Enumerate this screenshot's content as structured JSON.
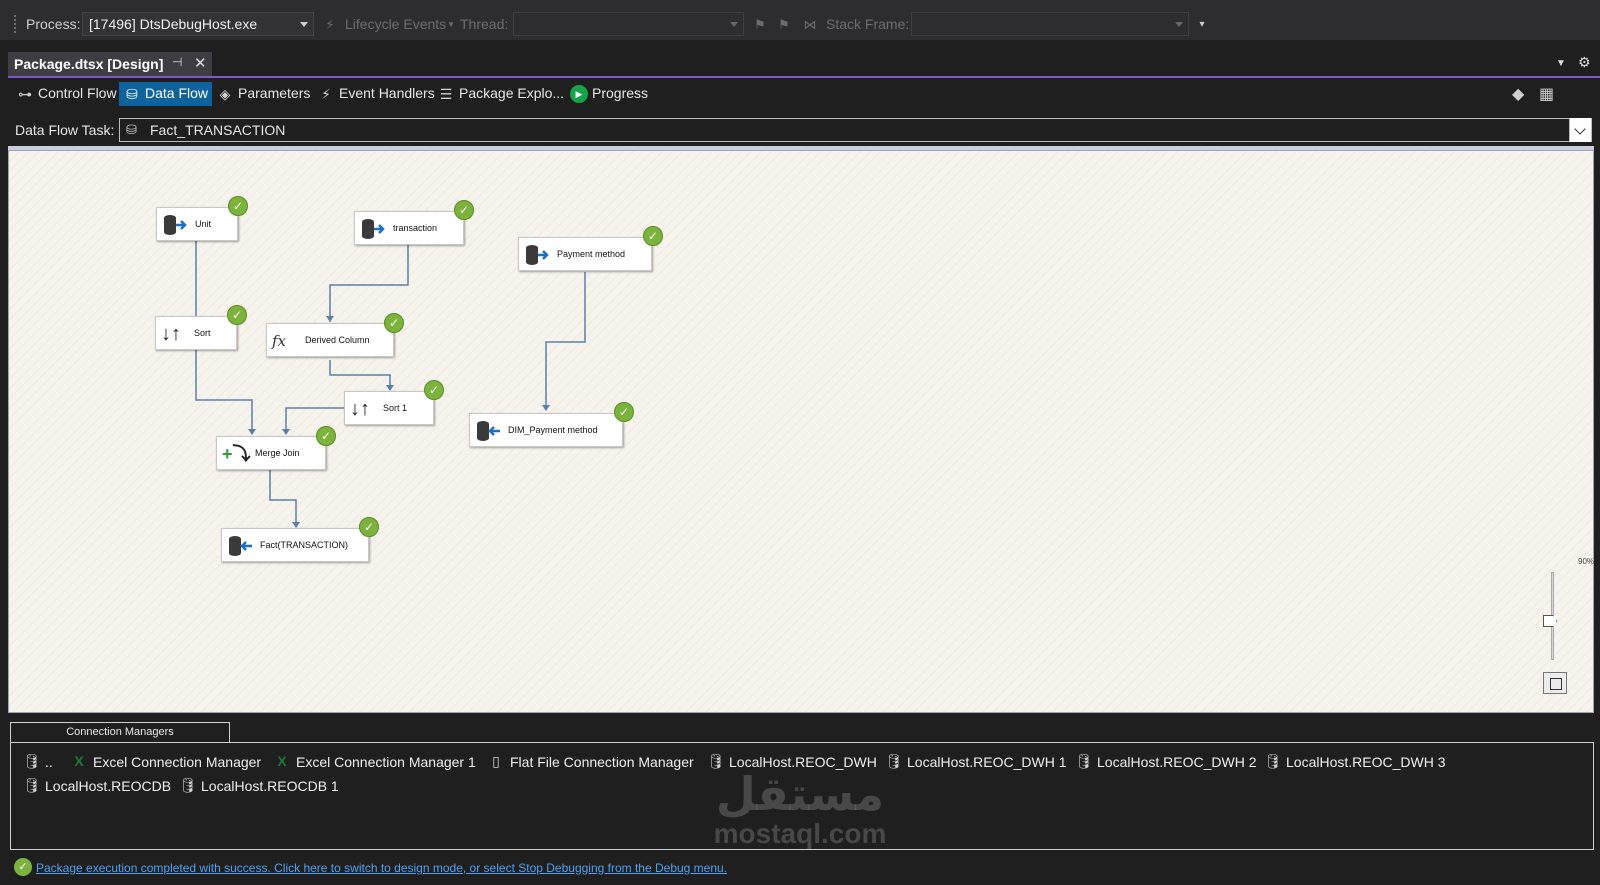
{
  "debug_toolbar": {
    "process_label": "Process:",
    "process_value": "[17496] DtsDebugHost.exe",
    "lifecycle_label": "Lifecycle Events",
    "thread_label": "Thread:",
    "stack_frame_label": "Stack Frame:"
  },
  "document_tab": {
    "title": "Package.dtsx [Design]",
    "pin_icon": "pin-icon",
    "close_icon": "close-icon"
  },
  "designer_tabs": [
    {
      "label": "Control Flow",
      "icon": "control-flow-icon"
    },
    {
      "label": "Data Flow",
      "icon": "data-flow-icon",
      "active": true
    },
    {
      "label": "Parameters",
      "icon": "parameters-icon"
    },
    {
      "label": "Event Handlers",
      "icon": "event-handlers-icon"
    },
    {
      "label": "Package Explo...",
      "icon": "package-explorer-icon"
    },
    {
      "label": "Progress",
      "icon": "progress-icon"
    }
  ],
  "task": {
    "label": "Data Flow Task:",
    "value": "Fact_TRANSACTION"
  },
  "components": {
    "unit": "Unit",
    "transaction": "transaction",
    "payment_method": "Payment method",
    "sort": "Sort",
    "derived_column": "Derived Column",
    "sort1": "Sort 1",
    "merge_join": "Merge Join",
    "dim_payment_method": "DIM_Payment method",
    "fact_transaction": "Fact(TRANSACTION)"
  },
  "zoom": {
    "label": "90%",
    "value": 90
  },
  "connection_managers": {
    "tab_label": "Connection Managers",
    "items": [
      {
        "label": "..",
        "icon": "database-icon"
      },
      {
        "label": "Excel Connection Manager",
        "icon": "excel-icon"
      },
      {
        "label": "Excel Connection Manager 1",
        "icon": "excel-icon"
      },
      {
        "label": "Flat File Connection Manager",
        "icon": "flat-file-icon"
      },
      {
        "label": "LocalHost.REOC_DWH",
        "icon": "database-icon"
      },
      {
        "label": "LocalHost.REOC_DWH 1",
        "icon": "database-icon"
      },
      {
        "label": "LocalHost.REOC_DWH 2",
        "icon": "database-icon"
      },
      {
        "label": "LocalHost.REOC_DWH 3",
        "icon": "database-icon"
      },
      {
        "label": "LocalHost.REOCDB",
        "icon": "database-icon"
      },
      {
        "label": "LocalHost.REOCDB 1",
        "icon": "database-icon"
      }
    ]
  },
  "status": {
    "message": "Package execution completed with success. Click here to switch to design mode, or select Stop Debugging from the Debug menu."
  },
  "watermark": {
    "arabic": "مستقل",
    "latin": "mostaql.com"
  },
  "colors": {
    "accent": "#0e639c",
    "success": "#7bb33c",
    "tab_underline": "#7e57c2",
    "canvas_bg": "#f6f3ec",
    "link": "#4ea1f3"
  }
}
